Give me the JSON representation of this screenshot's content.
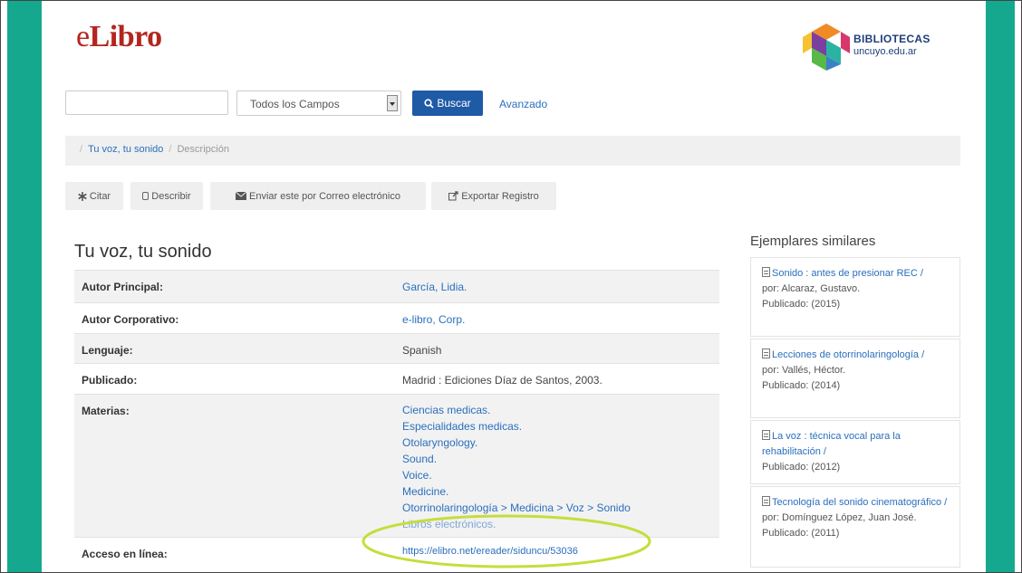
{
  "brand": {
    "logo_prefix": "e",
    "logo_main": "Libro"
  },
  "partner": {
    "title": "BIBLIOTECAS",
    "subtitle": "uncuyo.edu.ar"
  },
  "search": {
    "input_value": "",
    "field_selected": "Todos los Campos",
    "button_label": "Buscar",
    "advanced_label": "Avanzado"
  },
  "breadcrumb": {
    "items": [
      "Tu voz, tu sonido",
      "Descripción"
    ]
  },
  "actions": {
    "cite": "Citar",
    "describe": "Describir",
    "email": "Enviar este por Correo electrónico",
    "export": "Exportar Registro"
  },
  "record": {
    "title": "Tu voz, tu sonido",
    "rows": [
      {
        "label": "Autor Principal:",
        "value": "García, Lidia."
      },
      {
        "label": "Autor Corporativo:",
        "value": "e-libro, Corp."
      },
      {
        "label": "Lenguaje:",
        "value": "Spanish"
      },
      {
        "label": "Publicado:",
        "value": "Madrid : Ediciones Díaz de Santos, 2003."
      },
      {
        "label": "Materias:",
        "values": [
          "Ciencias medicas.",
          "Especialidades medicas.",
          "Otolaryngology.",
          "Sound.",
          "Voice.",
          "Medicine.",
          "Otorrinolaringología > Medicina > Voz > Sonido",
          "Libros electrónicos."
        ]
      },
      {
        "label": "Acceso en línea:",
        "value": "https://elibro.net/ereader/siduncu/53036"
      }
    ]
  },
  "similar": {
    "title": "Ejemplares similares",
    "items": [
      {
        "title": "Sonido : antes de presionar REC /",
        "author": "por: Alcaraz, Gustavo.",
        "published": "Publicado: (2015)"
      },
      {
        "title": "Lecciones de otorrinolaringología /",
        "author": "por: Vallés, Héctor.",
        "published": "Publicado: (2014)"
      },
      {
        "title": "La voz : técnica vocal para la rehabilitación /",
        "author": "",
        "published": "Publicado: (2012)"
      },
      {
        "title": "Tecnología del sonido cinematográfico /",
        "author": "por: Domínguez López, Juan José.",
        "published": "Publicado: (2011)"
      }
    ]
  },
  "colors": {
    "frame": "#15a88f",
    "brand_red": "#b3261e",
    "primary_button": "#1f5aa6",
    "link": "#2a6fbd",
    "highlight_ellipse": "#c6dd3c"
  }
}
